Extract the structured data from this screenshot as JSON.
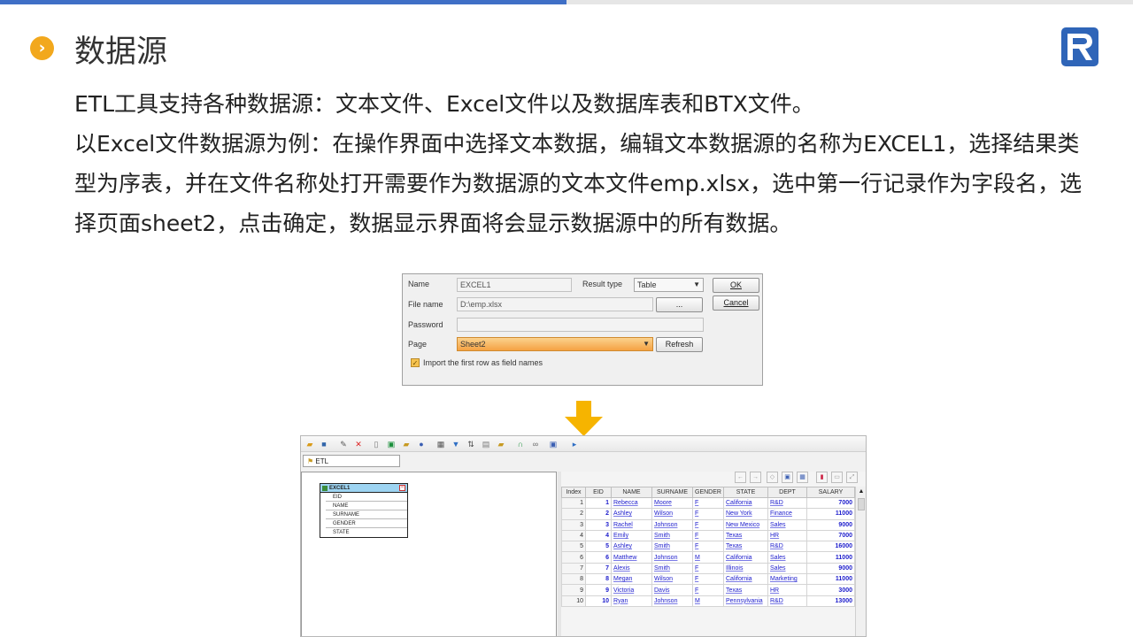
{
  "slide": {
    "title": "数据源",
    "bullet_icon": "chevron-right-icon",
    "logo_icon": "r-logo-icon",
    "accent_color": "#3f6fc6",
    "bullet_color": "#f2a81d",
    "paragraph1": "ETL工具支持各种数据源：文本文件、Excel文件以及数据库表和BTX文件。",
    "paragraph2": "以Excel文件数据源为例：在操作界面中选择文本数据，编辑文本数据源的名称为EXCEL1，选择结果类型为序表，并在文件名称处打开需要作为数据源的文本文件emp.xlsx，选中第一行记录作为字段名，选择页面sheet2，点击确定，数据显示界面将会显示数据源中的所有数据。"
  },
  "dialog": {
    "name_label": "Name",
    "name_value": "EXCEL1",
    "result_type_label": "Result type",
    "result_type_value": "Table",
    "ok_label": "OK",
    "cancel_label": "Cancel",
    "file_name_label": "File name",
    "file_name_value": "D:\\emp.xlsx",
    "browse_label": "...",
    "password_label": "Password",
    "password_value": "",
    "page_label": "Page",
    "page_value": "Sheet2",
    "refresh_label": "Refresh",
    "import_checkbox_label": "Import the first row as field names",
    "import_checked": true
  },
  "etl": {
    "tab_label": "ETL",
    "node": {
      "title": "EXCEL1",
      "fields": [
        "EID",
        "NAME",
        "SURNAME",
        "GENDER",
        "STATE"
      ]
    },
    "grid": {
      "columns": [
        "Index",
        "EID",
        "NAME",
        "SURNAME",
        "GENDER",
        "STATE",
        "DEPT",
        "SALARY"
      ],
      "rows": [
        [
          "1",
          "1",
          "Rebecca",
          "Moore",
          "F",
          "California",
          "R&D",
          "7000"
        ],
        [
          "2",
          "2",
          "Ashley",
          "Wilson",
          "F",
          "New York",
          "Finance",
          "11000"
        ],
        [
          "3",
          "3",
          "Rachel",
          "Johnson",
          "F",
          "New Mexico",
          "Sales",
          "9000"
        ],
        [
          "4",
          "4",
          "Emily",
          "Smith",
          "F",
          "Texas",
          "HR",
          "7000"
        ],
        [
          "5",
          "5",
          "Ashley",
          "Smith",
          "F",
          "Texas",
          "R&D",
          "16000"
        ],
        [
          "6",
          "6",
          "Matthew",
          "Johnson",
          "M",
          "California",
          "Sales",
          "11000"
        ],
        [
          "7",
          "7",
          "Alexis",
          "Smith",
          "F",
          "Illinois",
          "Sales",
          "9000"
        ],
        [
          "8",
          "8",
          "Megan",
          "Wilson",
          "F",
          "California",
          "Marketing",
          "11000"
        ],
        [
          "9",
          "9",
          "Victoria",
          "Davis",
          "F",
          "Texas",
          "HR",
          "3000"
        ],
        [
          "10",
          "10",
          "Ryan",
          "Johnson",
          "M",
          "Pennsylvania",
          "R&D",
          "13000"
        ]
      ]
    }
  }
}
